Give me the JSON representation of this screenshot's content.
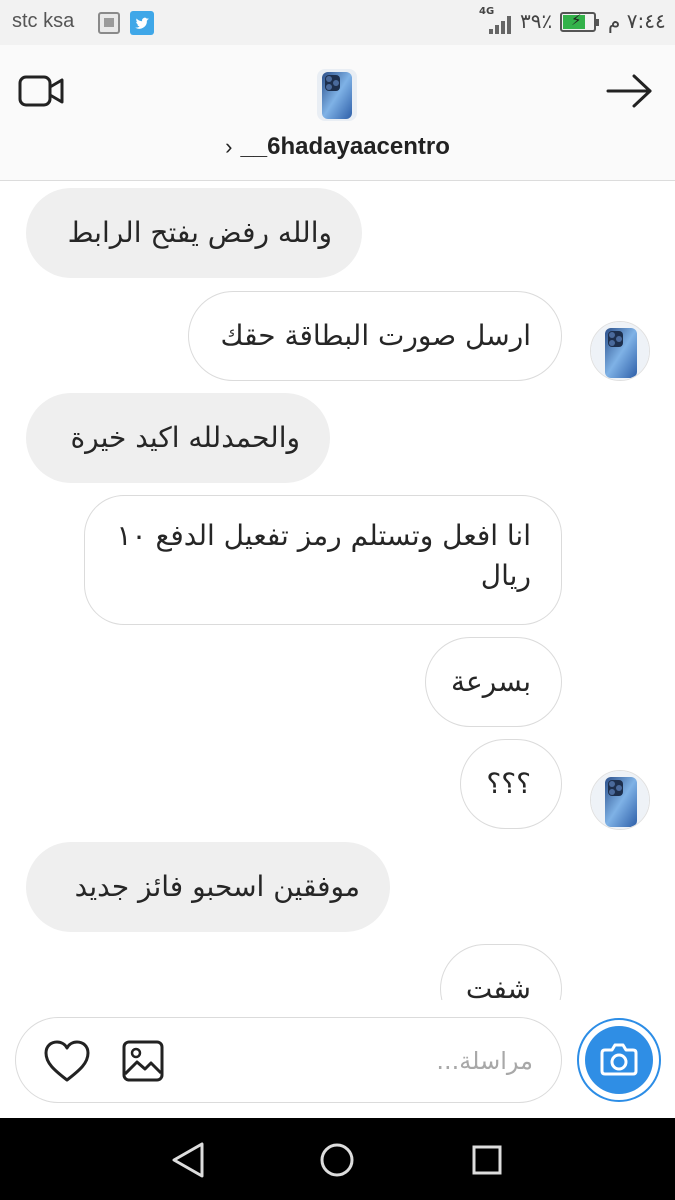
{
  "status_bar": {
    "carrier": "stc ksa",
    "network": "4G",
    "battery_percent": "٣٩٪",
    "time": "٧:٤٤ م",
    "icons": [
      "image-notification-icon",
      "twitter-icon",
      "signal-icon",
      "battery-charging-icon"
    ]
  },
  "header": {
    "username": "__6hadayaacentro",
    "chevron": "›",
    "icons": [
      "video-call-icon",
      "profile-avatar",
      "forward-arrow-icon"
    ]
  },
  "messages": [
    {
      "type": "received",
      "text": "والله رفض يفتح الرابط"
    },
    {
      "type": "sent",
      "text": "ارسل صورت البطاقة حقك",
      "avatar": true
    },
    {
      "type": "received",
      "text": "والحمدلله اكيد خيرة"
    },
    {
      "type": "sent",
      "text": "انا افعل وتستلم رمز تفعيل الدفع ١٠ ريال"
    },
    {
      "type": "sent",
      "text": "بسرعة"
    },
    {
      "type": "sent",
      "text": "؟؟؟",
      "avatar": true
    },
    {
      "type": "received",
      "text": "موفقين اسحبو فائز جديد"
    },
    {
      "type": "sent",
      "text": "شفت"
    }
  ],
  "composer": {
    "placeholder": "مراسلة...",
    "value": "",
    "icons": [
      "heart-icon",
      "gallery-icon",
      "camera-icon"
    ]
  },
  "nav_bar": {
    "icons": [
      "back-triangle-icon",
      "home-circle-icon",
      "recents-square-icon"
    ]
  },
  "colors": {
    "accent": "#3897f0",
    "received_bubble": "#efefef",
    "sent_border": "#dbdbdb",
    "battery": "#33b24a"
  }
}
